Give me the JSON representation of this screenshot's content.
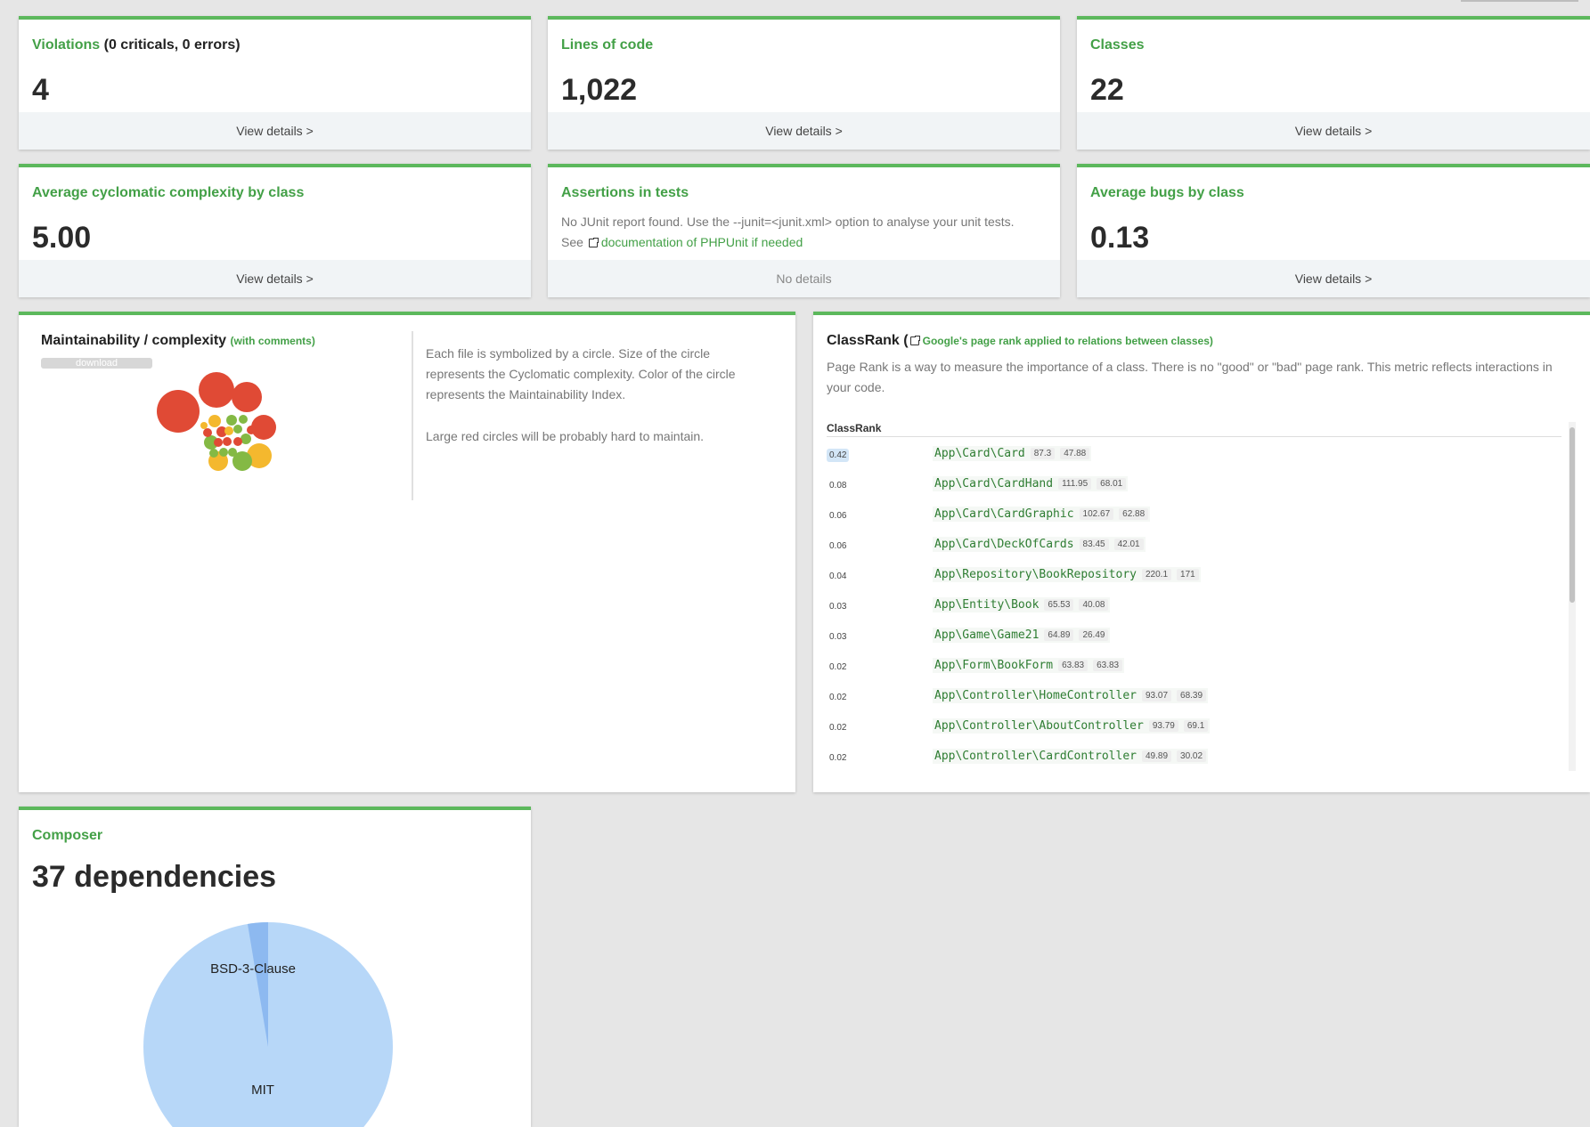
{
  "cards": {
    "violations": {
      "title": "Violations",
      "subtitle": "(0 criticals, 0 errors)",
      "value": "4",
      "footer": "View details >"
    },
    "loc": {
      "title": "Lines of code",
      "value": "1,022",
      "footer": "View details >"
    },
    "classes": {
      "title": "Classes",
      "value": "22",
      "footer": "View details >"
    },
    "complexity": {
      "title": "Average cyclomatic complexity by class",
      "value": "5.00",
      "footer": "View details >"
    },
    "assertions": {
      "title": "Assertions in tests",
      "desc_line1": "No JUnit report found. Use the --junit=<junit.xml> option to analyse your unit tests.",
      "desc_see": "See",
      "desc_link": "documentation of PHPUnit if needed",
      "footer": "No details"
    },
    "bugs": {
      "title": "Average bugs by class",
      "value": "0.13",
      "footer": "View details >"
    }
  },
  "maintainability": {
    "title": "Maintainability / complexity",
    "subtitle": "(with comments)",
    "download_label": "download",
    "desc_p1": "Each file is symbolized by a circle. Size of the circle represents the Cyclomatic complexity. Color of the circle represents the Maintainability Index.",
    "desc_p2": "Large red circles will be probably hard to maintain.",
    "colors": {
      "red": "#e04a35",
      "orange": "#f4b82e",
      "green": "#84b944"
    }
  },
  "classrank": {
    "title": "ClassRank",
    "paren_open": "(",
    "subtitle": "Google's page rank applied to relations between classes)",
    "desc": "Page Rank is a way to measure the importance of a class. There is no \"good\" or \"bad\" page rank. This metric reflects interactions in your code.",
    "column_header": "ClassRank",
    "rows": [
      {
        "rank": "0.42",
        "name": "App\\Card\\Card",
        "b1": "87.3",
        "b2": "47.88"
      },
      {
        "rank": "0.08",
        "name": "App\\Card\\CardHand",
        "b1": "111.95",
        "b2": "68.01"
      },
      {
        "rank": "0.06",
        "name": "App\\Card\\CardGraphic",
        "b1": "102.67",
        "b2": "62.88"
      },
      {
        "rank": "0.06",
        "name": "App\\Card\\DeckOfCards",
        "b1": "83.45",
        "b2": "42.01"
      },
      {
        "rank": "0.04",
        "name": "App\\Repository\\BookRepository",
        "b1": "220.1",
        "b2": "171"
      },
      {
        "rank": "0.03",
        "name": "App\\Entity\\Book",
        "b1": "65.53",
        "b2": "40.08"
      },
      {
        "rank": "0.03",
        "name": "App\\Game\\Game21",
        "b1": "64.89",
        "b2": "26.49"
      },
      {
        "rank": "0.02",
        "name": "App\\Form\\BookForm",
        "b1": "63.83",
        "b2": "63.83"
      },
      {
        "rank": "0.02",
        "name": "App\\Controller\\HomeController",
        "b1": "93.07",
        "b2": "68.39"
      },
      {
        "rank": "0.02",
        "name": "App\\Controller\\AboutController",
        "b1": "93.79",
        "b2": "69.1"
      },
      {
        "rank": "0.02",
        "name": "App\\Controller\\CardController",
        "b1": "49.89",
        "b2": "30.02"
      }
    ]
  },
  "composer": {
    "title": "Composer",
    "value": "37 dependencies",
    "labels": {
      "bsd": "BSD-3-Clause",
      "mit": "MIT"
    },
    "colors": {
      "mit": "#b7d7f8",
      "bsd": "#8db9f0"
    }
  }
}
